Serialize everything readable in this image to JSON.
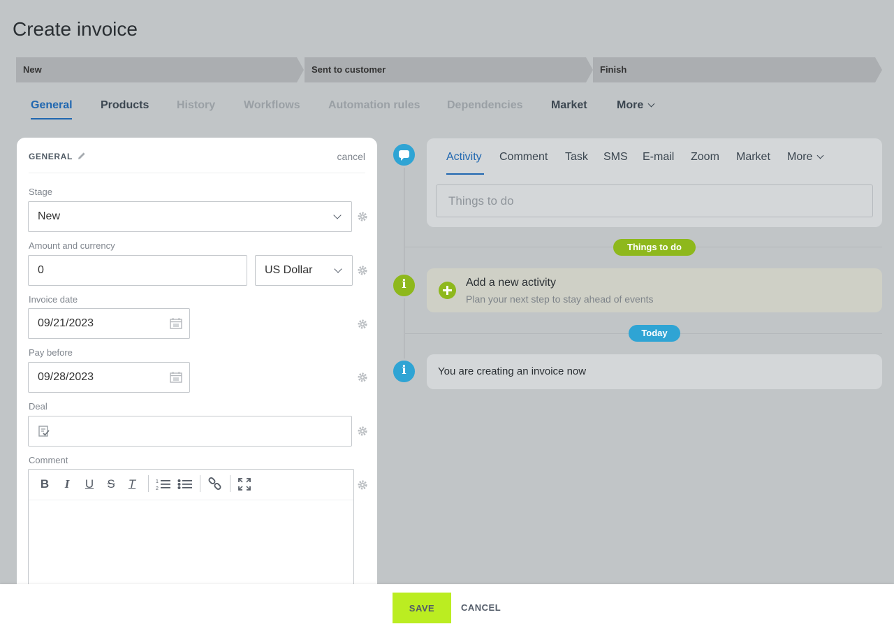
{
  "page": {
    "title": "Create invoice"
  },
  "stages": [
    {
      "label": "New"
    },
    {
      "label": "Sent to customer"
    },
    {
      "label": "Finish"
    }
  ],
  "tabs": [
    {
      "label": "General",
      "state": "active"
    },
    {
      "label": "Products",
      "state": "enabled"
    },
    {
      "label": "History",
      "state": "disabled"
    },
    {
      "label": "Workflows",
      "state": "disabled"
    },
    {
      "label": "Automation rules",
      "state": "disabled"
    },
    {
      "label": "Dependencies",
      "state": "disabled"
    },
    {
      "label": "Market",
      "state": "enabled"
    },
    {
      "label": "More",
      "state": "enabled"
    }
  ],
  "form": {
    "section_title": "GENERAL",
    "cancel_label": "cancel",
    "stage": {
      "label": "Stage",
      "value": "New"
    },
    "amount": {
      "label": "Amount and currency",
      "value": "0",
      "currency": "US Dollar"
    },
    "invoice_date": {
      "label": "Invoice date",
      "value": "09/21/2023"
    },
    "pay_before": {
      "label": "Pay before",
      "value": "09/28/2023"
    },
    "deal": {
      "label": "Deal",
      "value": ""
    },
    "comment": {
      "label": "Comment",
      "value": ""
    },
    "toolbar": {
      "bold": "B",
      "italic": "I",
      "underline": "U",
      "strike": "S",
      "clear": "T"
    }
  },
  "activity": {
    "tabs": [
      "Activity",
      "Comment",
      "Task",
      "SMS",
      "E-mail",
      "Zoom",
      "Market",
      "More"
    ],
    "placeholder": "Things to do",
    "things_to_do_pill": "Things to do",
    "add_title": "Add a new activity",
    "add_subtitle": "Plan your next step to stay ahead of events",
    "today_pill": "Today",
    "message": "You are creating an invoice now",
    "info_icon": "i"
  },
  "footer": {
    "save": "SAVE",
    "cancel": "CANCEL"
  },
  "colors": {
    "accent": "#2067b0",
    "save": "#bbed21",
    "green": "#8eb81c",
    "blue": "#2fa4d4"
  }
}
